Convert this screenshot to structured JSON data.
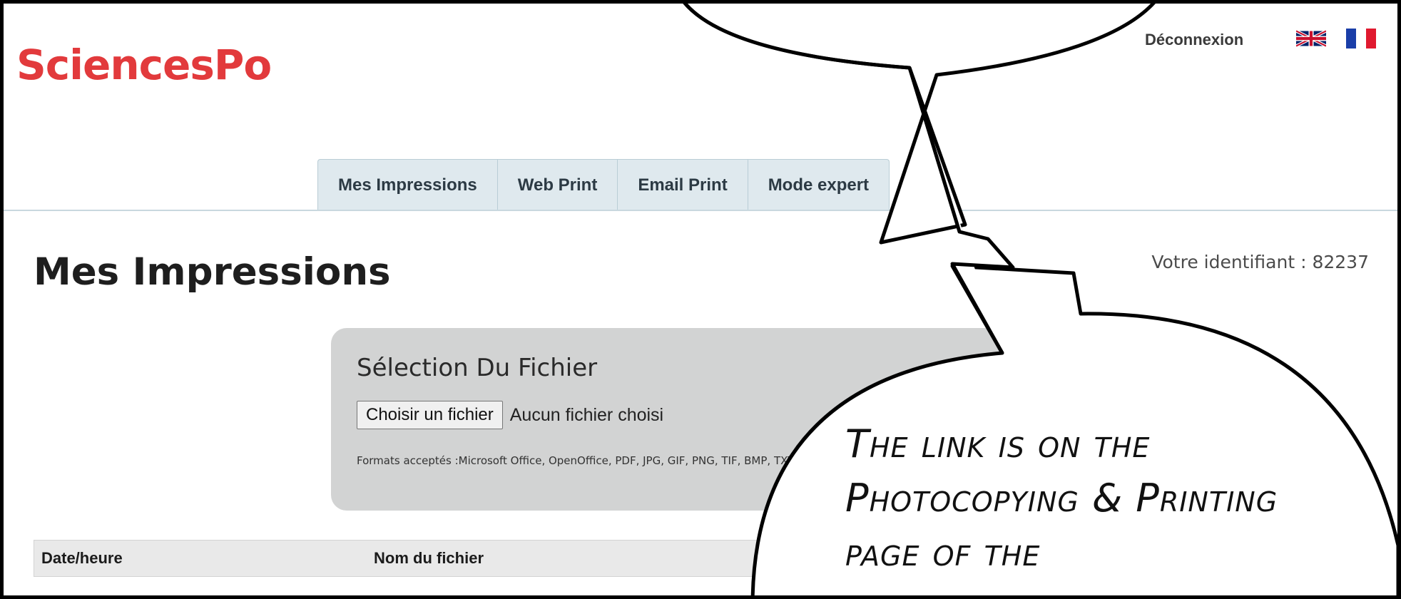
{
  "brand": {
    "logo_text": "SciencesPo",
    "accent": "#e23a3c"
  },
  "header": {
    "logout_label": "Déconnexion",
    "languages": [
      {
        "name": "uk-flag-icon"
      },
      {
        "name": "fr-flag-icon"
      }
    ]
  },
  "tabs": [
    {
      "label": "Mes Impressions",
      "active": true
    },
    {
      "label": "Web Print"
    },
    {
      "label": "Email Print"
    },
    {
      "label": "Mode expert"
    }
  ],
  "main": {
    "title": "Mes Impressions",
    "user_id_text": "Votre identifiant : 82237"
  },
  "upload": {
    "title": "Sélection Du Fichier",
    "choose_button": "Choisir un fichier",
    "file_status": "Aucun fichier choisi",
    "formats": "Formats acceptés :Microsoft Office, OpenOffice, PDF, JPG, GIF, PNG, TIF, BMP, TXT"
  },
  "table": {
    "columns": [
      "Date/heure",
      "Nom du fichier"
    ]
  },
  "callout": {
    "text": "The link is on the Photocopying & Printing page of the"
  }
}
